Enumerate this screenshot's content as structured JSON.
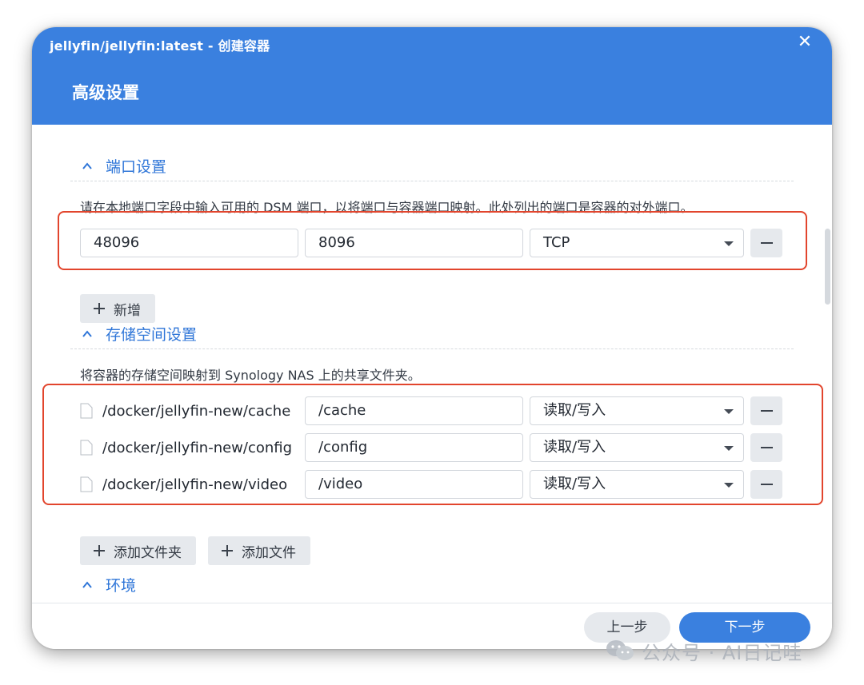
{
  "window": {
    "title": "jellyfin/jellyfin:latest - 创建容器",
    "heading": "高级设置",
    "close_glyph": "✕"
  },
  "port_section": {
    "title": "端口设置",
    "description": "请在本地端口字段中输入可用的 DSM 端口，以将端口与容器端口映射。此处列出的端口是容器的对外端口。",
    "rows": [
      {
        "local_port": "48096",
        "container_port": "8096",
        "protocol": "TCP"
      }
    ],
    "add_label": "新增"
  },
  "storage_section": {
    "title": "存储空间设置",
    "description": "将容器的存储空间映射到 Synology NAS 上的共享文件夹。",
    "rows": [
      {
        "host_path": "/docker/jellyfin-new/cache",
        "mount_path": "/cache",
        "permission": "读取/写入"
      },
      {
        "host_path": "/docker/jellyfin-new/config",
        "mount_path": "/config",
        "permission": "读取/写入"
      },
      {
        "host_path": "/docker/jellyfin-new/video",
        "mount_path": "/video",
        "permission": "读取/写入"
      }
    ],
    "add_folder_label": "添加文件夹",
    "add_file_label": "添加文件"
  },
  "env_section": {
    "title": "环境"
  },
  "footer": {
    "prev_label": "上一步",
    "next_label": "下一步"
  },
  "watermark": {
    "text": "公众号 · AI日记哇"
  },
  "colors": {
    "header_blue": "#3a80df",
    "section_blue": "#2f76d8",
    "highlight_red": "#e2452d",
    "button_gray": "#e6e9ed"
  },
  "icons": [
    "close-icon",
    "chevron-up-icon",
    "plus-icon",
    "minus-icon",
    "dropdown-arrow-icon",
    "file-icon",
    "wechat-icon"
  ]
}
